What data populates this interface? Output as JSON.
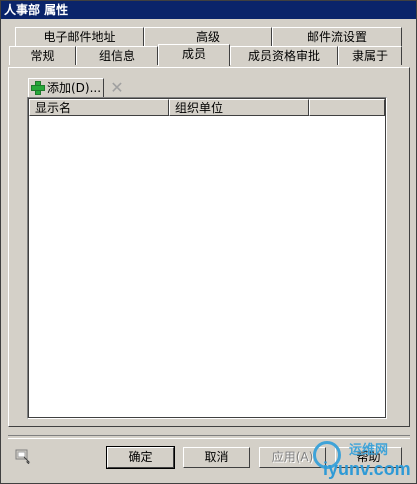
{
  "window": {
    "title": "人事部 属性"
  },
  "tabs_row1": [
    {
      "label": "电子邮件地址"
    },
    {
      "label": "高级"
    },
    {
      "label": "邮件流设置"
    }
  ],
  "tabs_row2": [
    {
      "label": "常规"
    },
    {
      "label": "组信息"
    },
    {
      "label": "成员",
      "active": true
    },
    {
      "label": "成员资格审批"
    },
    {
      "label": "隶属于"
    }
  ],
  "toolbar": {
    "add_label": "添加(D)...",
    "remove_icon": "close-icon"
  },
  "list": {
    "columns": [
      {
        "label": "显示名"
      },
      {
        "label": "组织单位"
      },
      {
        "label": ""
      }
    ],
    "rows": []
  },
  "buttons": {
    "ok": "确定",
    "cancel": "取消",
    "apply": "应用(A)",
    "help": "帮助"
  },
  "watermark": {
    "line1": "运维网",
    "line2": "iyunv.com"
  },
  "colors": {
    "titlebar": "#0a246a",
    "dialog_bg": "#d4d0c8",
    "add_icon": "#27a83a"
  }
}
